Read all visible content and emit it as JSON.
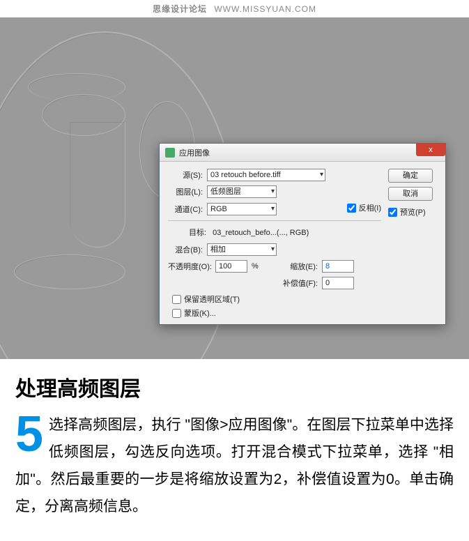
{
  "watermark": {
    "site": "思缘设计论坛",
    "url": "WWW.MISSYUAN.COM"
  },
  "dialog": {
    "title": "应用图像",
    "close_label": "x",
    "source": {
      "label": "源(S):",
      "value": "03 retouch before.tiff"
    },
    "layer": {
      "label": "图层(L):",
      "value": "低频图层"
    },
    "channel": {
      "label": "通道(C):",
      "value": "RGB",
      "invert_label": "反相(I)",
      "invert_checked": true
    },
    "target": {
      "label": "目标:",
      "value": "03_retouch_befo...(..., RGB)"
    },
    "blend": {
      "label": "混合(B):",
      "value": "相加"
    },
    "opacity": {
      "label": "不透明度(O):",
      "value": "100",
      "unit": "%"
    },
    "scale": {
      "label": "缩放(E):",
      "value": "8"
    },
    "offset": {
      "label": "补偿值(F):",
      "value": "0"
    },
    "preserve_transparency": {
      "label": "保留透明区域(T)",
      "checked": false
    },
    "mask": {
      "label": "蒙版(K)...",
      "checked": false
    },
    "ok": "确定",
    "cancel": "取消",
    "preview": {
      "label": "预览(P)",
      "checked": true
    }
  },
  "article": {
    "heading": "处理高频图层",
    "step_number": "5",
    "body": "选择高频图层，执行 \"图像>应用图像\"。在图层下拉菜单中选择低频图层，勾选反向选项。打开混合模式下拉菜单，选择 \"相加\"。然后最重要的一步是将缩放设置为2，补偿值设置为0。单击确定，分离高频信息。"
  }
}
